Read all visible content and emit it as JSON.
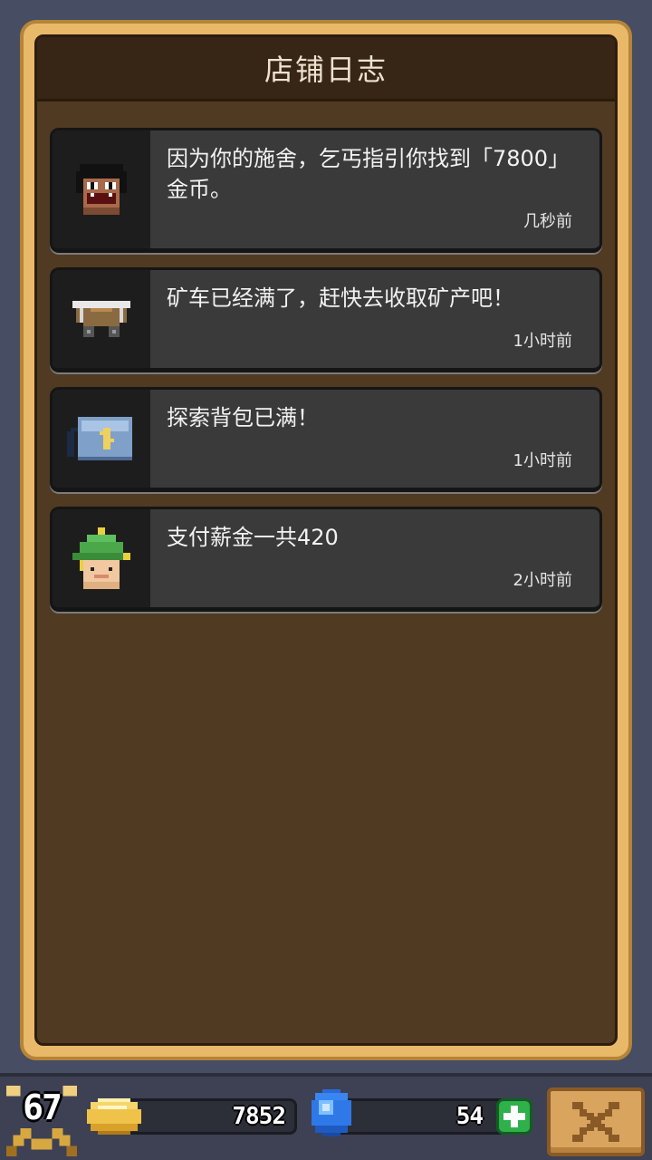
{
  "panel": {
    "title": "店铺日志"
  },
  "log_entries": [
    {
      "icon": "beggar-icon",
      "text": "因为你的施舍，乞丐指引你找到「7800」金币。",
      "time": "几秒前"
    },
    {
      "icon": "minecart-icon",
      "text": "矿车已经满了，赶快去收取矿产吧！",
      "time": "1小时前"
    },
    {
      "icon": "backpack-icon",
      "text": "探索背包已满！",
      "time": "1小时前"
    },
    {
      "icon": "miner-icon",
      "text": "支付薪金一共420",
      "time": "2小时前"
    }
  ],
  "bottom_bar": {
    "level": "67",
    "gold": "7852",
    "gems": "54",
    "level_icon": "crossed-pickaxes-icon",
    "gold_icon": "gold-coin-icon",
    "gem_icon": "blue-gem-icon",
    "add_icon": "plus-icon",
    "close_icon": "close-icon"
  },
  "colors": {
    "panel_border": "#e9b96a",
    "panel_bg": "#513a22",
    "card_bg": "#3a3a3a",
    "add_button": "#2fb04a",
    "close_button": "#d9a45e"
  }
}
